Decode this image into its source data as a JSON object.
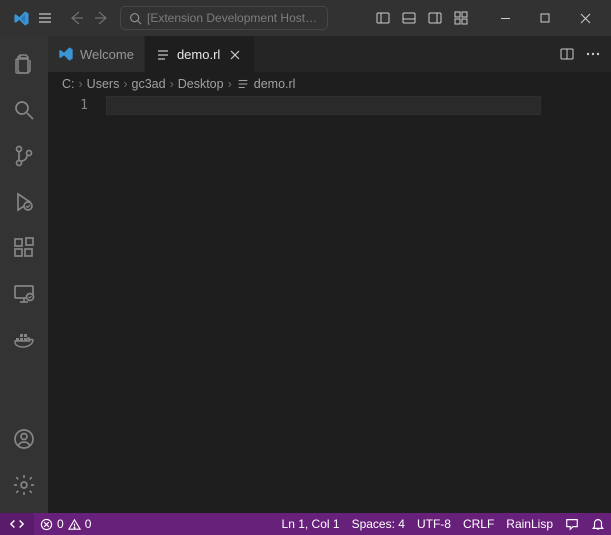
{
  "titlebar": {
    "search_prefix": "[Extension Development Host] Se..."
  },
  "tabs": {
    "welcome": "Welcome",
    "demo": "demo.rl"
  },
  "breadcrumb": {
    "seg0": "C:",
    "seg1": "Users",
    "seg2": "gc3ad",
    "seg3": "Desktop",
    "seg4": "demo.rl"
  },
  "gutter": {
    "line1": "1"
  },
  "status": {
    "errors": "0",
    "warnings": "0",
    "lncol": "Ln 1, Col 1",
    "spaces": "Spaces: 4",
    "encoding": "UTF-8",
    "eol": "CRLF",
    "lang": "RainLisp"
  }
}
